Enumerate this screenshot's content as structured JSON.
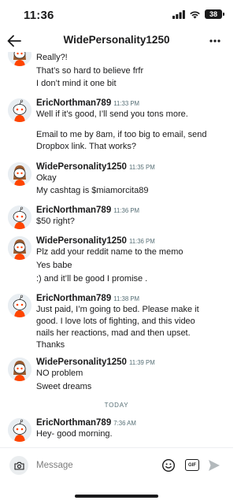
{
  "status_bar": {
    "time": "11:36",
    "battery": "38"
  },
  "header": {
    "title": "WidePersonality1250"
  },
  "top_partial_lines": [
    "Really?!",
    "That’s so hard to believe frfr",
    "I don’t mind it one bit"
  ],
  "messages": [
    {
      "user": "EricNorthman789",
      "time": "11:33 PM",
      "lines": [
        "Well if it’s good, I’ll send you tons more.",
        "",
        "Email to me by 8am, if too big to email, send",
        "Dropbox link. That works?"
      ]
    },
    {
      "user": "WidePersonality1250",
      "time": "11:35 PM",
      "lines": [
        "Okay",
        "My cashtag is $miamorcita89"
      ]
    },
    {
      "user": "EricNorthman789",
      "time": "11:36 PM",
      "lines": [
        "$50 right?"
      ]
    },
    {
      "user": "WidePersonality1250",
      "time": "11:36 PM",
      "lines": [
        "Plz add your reddit name to the memo",
        "Yes babe",
        ":) and it’ll be good I promise ."
      ]
    },
    {
      "user": "EricNorthman789",
      "time": "11:38 PM",
      "lines": [
        "Just paid, I’m going to bed. Please make it",
        "good. I love lots of fighting, and this video",
        "nails her reactions, mad and then upset.",
        "Thanks"
      ]
    },
    {
      "user": "WidePersonality1250",
      "time": "11:39 PM",
      "lines": [
        "NO problem",
        "Sweet dreams"
      ]
    },
    {
      "user": "EricNorthman789",
      "time": "7:36 AM",
      "lines": [
        "Hey- good morning."
      ]
    }
  ],
  "divider": {
    "label": "TODAY"
  },
  "composer": {
    "placeholder": "Message",
    "gif_label": "GIF"
  },
  "icons": {
    "back": "back-arrow-icon",
    "more": "more-horizontal-icon",
    "camera": "camera-icon",
    "emoji": "emoji-icon",
    "gif": "gif-icon",
    "send": "send-icon"
  },
  "colors": {
    "text": "#1a1a1b",
    "muted": "#576f76",
    "avatar_bg": "#e9eef2",
    "send_disabled": "#b3b9bc"
  }
}
